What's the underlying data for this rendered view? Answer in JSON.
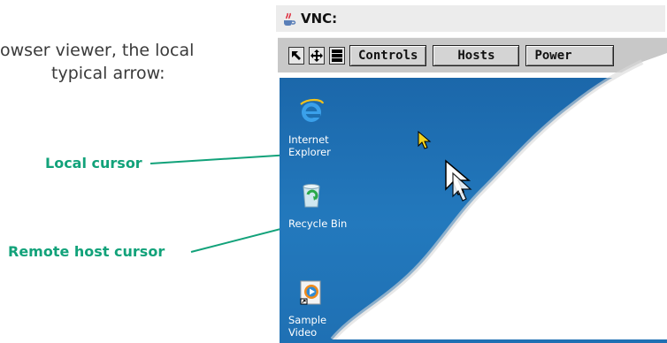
{
  "intro": {
    "line1": "owser viewer, the local",
    "line2": "typical arrow:"
  },
  "callouts": {
    "local_cursor": "Local cursor",
    "remote_cursor": "Remote host cursor",
    "color": "#12a27a"
  },
  "vnc": {
    "title": "VNC:",
    "toolbar": {
      "controls": "Controls",
      "hosts": "Hosts",
      "power": "Power",
      "ctrl_alt_del_icon": "ctrl-alt-del-icon",
      "resize_icon": "scale-arrow-icon",
      "move_icon": "move-icon"
    },
    "desktop_color": "#1d6fb1",
    "desktop_icons": [
      {
        "label_line1": "Internet",
        "label_line2": "Explorer",
        "icon": "internet-explorer-icon"
      },
      {
        "label_line1": "Recycle Bin",
        "label_line2": "",
        "icon": "recycle-bin-icon"
      },
      {
        "label_line1": "Sample Video",
        "label_line2": "",
        "icon": "media-player-icon"
      }
    ]
  }
}
